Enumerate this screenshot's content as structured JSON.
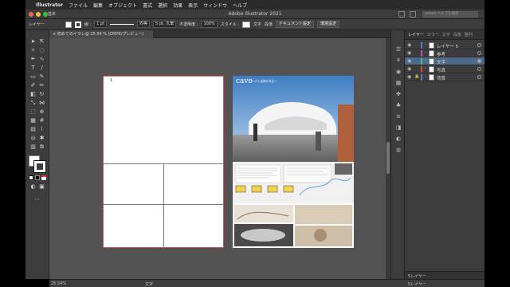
{
  "menubar": {
    "apple": "",
    "app_name": "Illustrator",
    "items": [
      "ファイル",
      "編集",
      "オブジェクト",
      "書式",
      "選択",
      "効果",
      "表示",
      "ウィンドウ",
      "ヘルプ"
    ]
  },
  "window": {
    "title": "Adobe Illustrator 2021",
    "workspace": "基本",
    "search_placeholder": "Adobe ヘルプを検索"
  },
  "control_bar": {
    "label": "レイヤー",
    "stroke_label": "線 :",
    "stroke_weight": "1 pt",
    "stroke_profile": "均等",
    "brush": "5 pt. 丸筆",
    "opacity_label": "不透明度 :",
    "opacity_value": "100%",
    "style_label": "スタイル :",
    "text_label": "文字",
    "para_label": "段落",
    "doc_setup_button": "ドキュメント設定",
    "prefs_button": "環境設定"
  },
  "document_tab": {
    "label": "初めてのイラレ@ 25.54 % (CMYK/プレビュー)"
  },
  "artboard1": {
    "number": "1"
  },
  "artboard2": {
    "heading": "cave",
    "subheading": "～人と自然の共生～"
  },
  "statusbar": {
    "zoom": "25.54%",
    "tool": "文字",
    "layers_count": "5レイヤー"
  },
  "layers_panel": {
    "tabs": [
      "レイヤー",
      "カラー",
      "文字",
      "段落",
      "整列"
    ],
    "active_tab": "レイヤー",
    "rows": [
      {
        "name": "レイヤー 5",
        "color": "#4f7dd4"
      },
      {
        "name": "参考",
        "color": "#c14dc1"
      },
      {
        "name": "文字",
        "color": "#4fc26e"
      },
      {
        "name": "写真",
        "color": "#d64a4a"
      },
      {
        "name": "背景",
        "color": "#4f7dd4"
      }
    ],
    "selected": "文字"
  },
  "colors": {
    "ui_dark": "#3c3c3c",
    "canvas": "#535353",
    "selection": "#4d6a8a",
    "artboard_border": "#cc5555"
  }
}
